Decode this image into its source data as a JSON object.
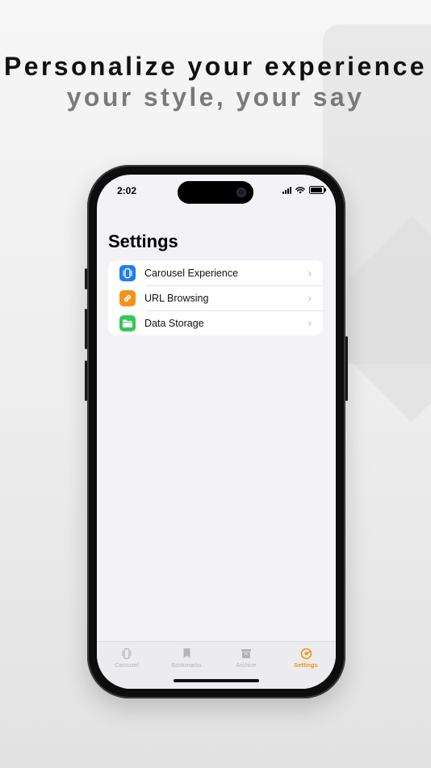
{
  "marketing": {
    "headline": "Personalize your experience",
    "subheadline": "your style, your say"
  },
  "status_bar": {
    "time": "2:02"
  },
  "settings": {
    "title": "Settings",
    "items": [
      {
        "label": "Carousel Experience",
        "icon": "carousel-icon",
        "color": "#1e7cf2"
      },
      {
        "label": "URL Browsing",
        "icon": "link-icon",
        "color": "#f5921b"
      },
      {
        "label": "Data Storage",
        "icon": "folder-icon",
        "color": "#34c759"
      }
    ]
  },
  "tabbar": {
    "tabs": [
      {
        "label": "Carousel",
        "icon": "carousel-icon",
        "active": false
      },
      {
        "label": "Bookmarks",
        "icon": "bookmark-icon",
        "active": false
      },
      {
        "label": "Archive",
        "icon": "archive-icon",
        "active": false
      },
      {
        "label": "Settings",
        "icon": "settings-icon",
        "active": true
      }
    ],
    "active_color": "#f5921b",
    "inactive_color": "#b5b5b8"
  }
}
